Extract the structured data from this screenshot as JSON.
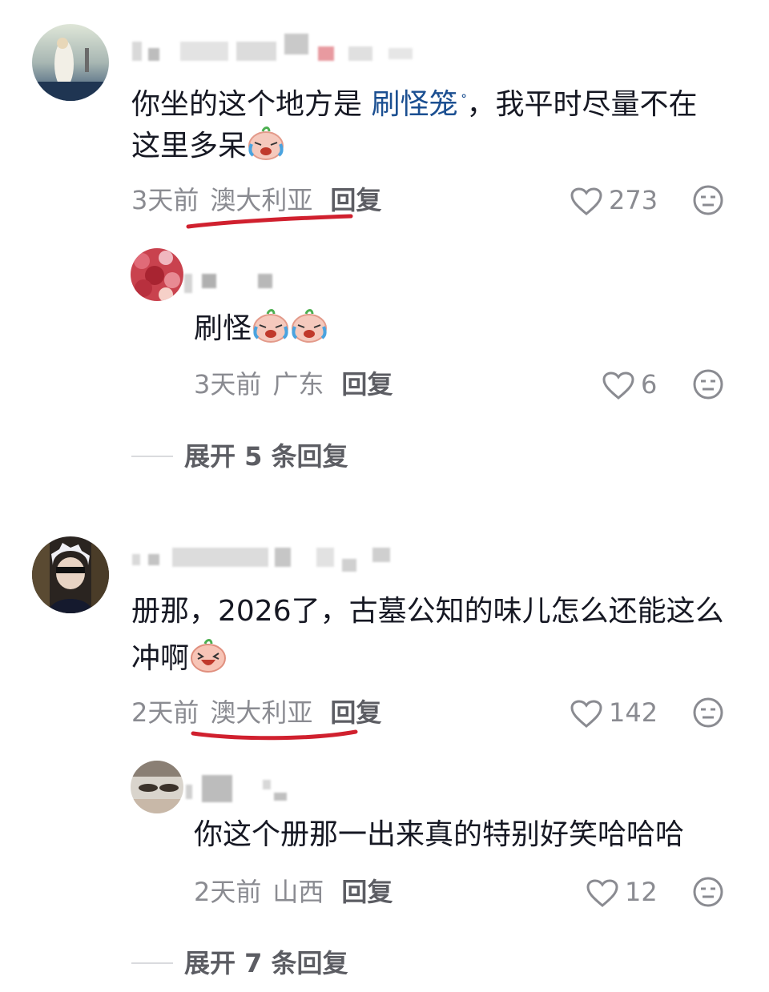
{
  "comments": [
    {
      "content_prefix": "你坐的这个地方是 ",
      "keyword": "刷怪笼",
      "keyword_mark": "ᐤ",
      "content_mid": "，我平时尽量不在",
      "content_line2": "这里多呆",
      "time": "3天前",
      "location": "澳大利亚",
      "reply_label": "回复",
      "likes": "273",
      "replies": [
        {
          "content": "刷怪",
          "time": "3天前",
          "location": "广东",
          "reply_label": "回复",
          "likes": "6"
        }
      ],
      "expand_label": "展开 5 条回复"
    },
    {
      "content_line1": "册那，2026了，古墓公知的味儿怎么还能这么",
      "content_line2": "冲啊",
      "time": "2天前",
      "location": "澳大利亚",
      "reply_label": "回复",
      "likes": "142",
      "replies": [
        {
          "content": "你这个册那一出来真的特别好笑哈哈哈",
          "time": "2天前",
          "location": "山西",
          "reply_label": "回复",
          "likes": "12"
        }
      ],
      "expand_label": "展开 7 条回复"
    }
  ],
  "icons": {
    "like": "heart-outline-icon",
    "dislike": "neutral-face-icon",
    "emoji_cry": "crying-laughing-emoji",
    "emoji_laugh": "laughing-emoji"
  },
  "colors": {
    "keyword": "#1b4f91",
    "underline": "#d0202e",
    "meta": "#8a8b91"
  }
}
